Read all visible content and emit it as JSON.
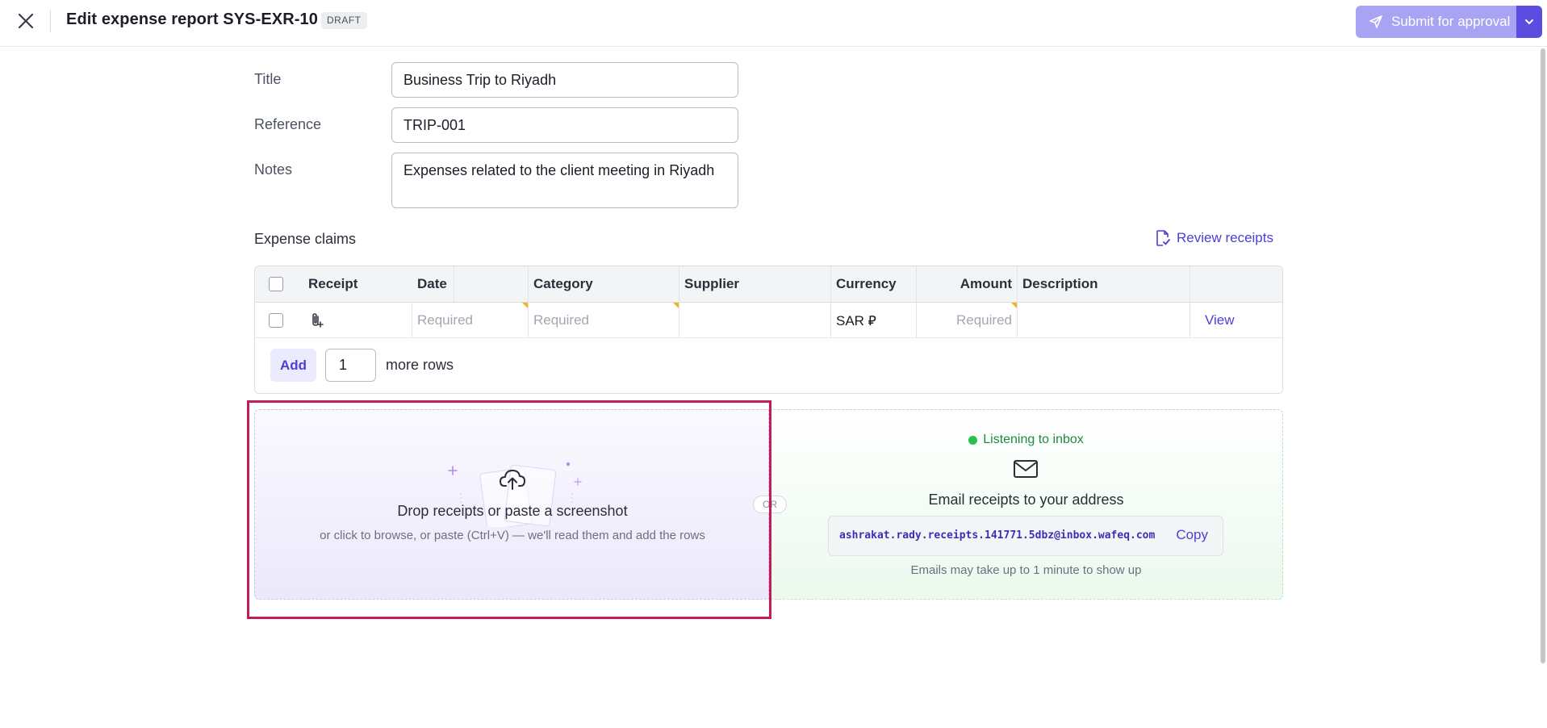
{
  "header": {
    "title": "Edit expense report SYS-EXR-10",
    "status_badge": "DRAFT",
    "submit_label": "Submit for approval"
  },
  "form": {
    "title": {
      "label": "Title",
      "value": "Business Trip to Riyadh"
    },
    "reference": {
      "label": "Reference",
      "value": "TRIP-001"
    },
    "notes": {
      "label": "Notes",
      "value": "Expenses related to the client meeting in Riyadh"
    }
  },
  "claims": {
    "section_title": "Expense claims",
    "review_label": "Review receipts",
    "columns": [
      "Receipt",
      "Date",
      "Category",
      "Supplier",
      "Currency",
      "Amount",
      "Description"
    ],
    "rows": [
      {
        "date": "Required",
        "category": "Required",
        "supplier": "",
        "currency": "SAR ⃁",
        "amount": "Required",
        "description": "",
        "action": "View"
      }
    ],
    "add_label": "Add",
    "add_count": "1",
    "more_rows_label": "more rows"
  },
  "upload": {
    "title": "Drop receipts or paste a screenshot",
    "subtitle": "or click to browse, or paste (Ctrl+V) — we'll read them and add the rows",
    "or_label": "OR"
  },
  "email": {
    "status": "Listening to inbox",
    "title": "Email receipts to your address",
    "address": "ashrakat.rady.receipts.141771.5dbz@inbox.wafeq.com",
    "copy_label": "Copy",
    "note": "Emails may take up to 1 minute to show up"
  },
  "colors": {
    "accent": "#4b3fd6",
    "submit_disabled": "#a9a3f3",
    "success": "#27c24c",
    "highlight": "#c41c5b"
  }
}
